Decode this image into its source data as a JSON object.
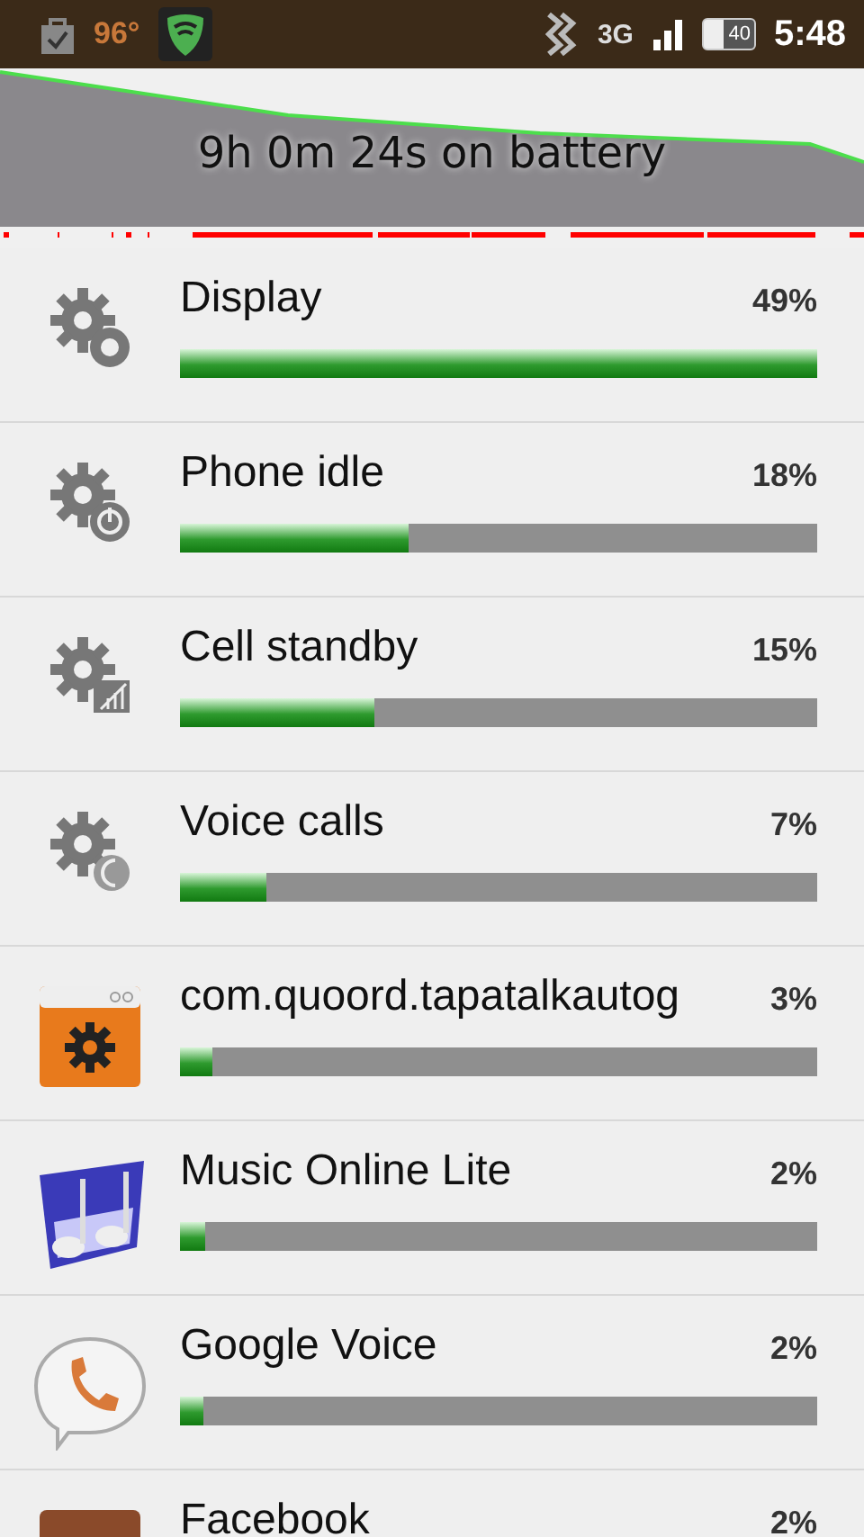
{
  "status_bar": {
    "temperature": "96°",
    "network": "3G",
    "battery": "40",
    "time": "5:48"
  },
  "graph": {
    "summary": "9h 0m 24s on battery"
  },
  "items": [
    {
      "name": "Display",
      "percent": "49%",
      "level": 1.0
    },
    {
      "name": "Phone idle",
      "percent": "18%",
      "level": 0.36
    },
    {
      "name": "Cell standby",
      "percent": "15%",
      "level": 0.305
    },
    {
      "name": "Voice calls",
      "percent": "7%",
      "level": 0.135
    },
    {
      "name": "com.quoord.tapatalkautog",
      "percent": "3%",
      "level": 0.05
    },
    {
      "name": "Music Online Lite",
      "percent": "2%",
      "level": 0.04
    },
    {
      "name": "Google Voice",
      "percent": "2%",
      "level": 0.037
    },
    {
      "name": "Facebook",
      "percent": "2%"
    }
  ]
}
